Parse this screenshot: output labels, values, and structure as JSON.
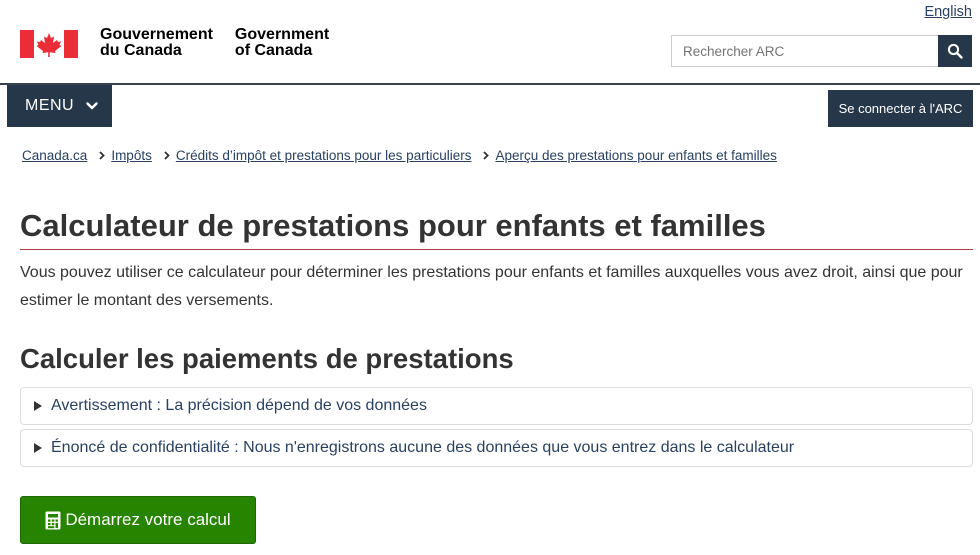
{
  "header": {
    "lang_link": "English",
    "wordmark_fr_1": "Gouvernement",
    "wordmark_fr_2": "du Canada",
    "wordmark_en_1": "Government",
    "wordmark_en_2": "of Canada",
    "search_placeholder": "Rechercher ARC",
    "menu_label": "MENU",
    "signin_label": "Se connecter à l'ARC"
  },
  "breadcrumb": [
    "Canada.ca",
    "Impôts",
    "Crédits d’impôt et prestations pour les particuliers",
    "Aperçu des prestations pour enfants et familles"
  ],
  "main": {
    "title": "Calculateur de prestations pour enfants et familles",
    "intro": "Vous pouvez utiliser ce calculateur pour déterminer les prestations pour enfants et familles auxquelles vous avez droit, ainsi que pour estimer le montant des versements.",
    "section_title": "Calculer les paiements de prestations",
    "details": [
      "Avertissement : La précision dépend de vos données",
      "Énoncé de confidentialité : Nous n'enregistrons aucune des données que vous entrez dans le calculateur"
    ],
    "start_button": "Démarrez votre calcul"
  },
  "colors": {
    "navy": "#26374a",
    "link": "#284162",
    "green": "#278400",
    "red": "#eb2d37",
    "title_rule": "#af3c43"
  },
  "icons": {
    "flag": "canada-flag-icon",
    "search": "search-icon",
    "menu": "chevron-down-icon",
    "breadcrumb": "chevron-right-icon",
    "details": "triangle-right-icon",
    "start": "calculator-icon"
  }
}
